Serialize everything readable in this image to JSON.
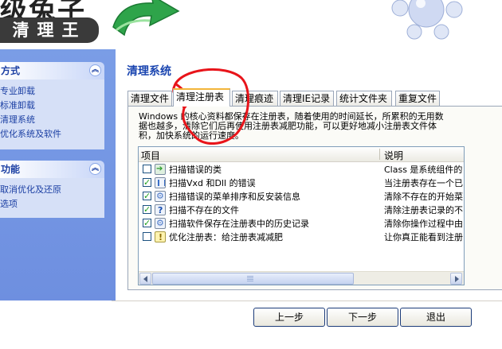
{
  "banner": {
    "logo_top_text": "级兔子",
    "logo_plate_text": "清理王"
  },
  "left_pane": {
    "panels": [
      {
        "title": "方式",
        "collapse_glyph": "︽",
        "items": [
          "专业卸载",
          "标准卸载",
          "清理系统",
          "优化系统及软件"
        ]
      },
      {
        "title": "功能",
        "collapse_glyph": "︽",
        "items": [
          "取消优化及还原",
          "选项"
        ]
      }
    ]
  },
  "main": {
    "title": "清理系统",
    "tabs": [
      {
        "label": "清理文件"
      },
      {
        "label": "清理注册表",
        "active": true
      },
      {
        "label": "清理痕迹"
      },
      {
        "label": "清理IE记录"
      },
      {
        "label": "统计文件夹"
      },
      {
        "label": "重复文件"
      }
    ],
    "description_lines": [
      "Windows 的核心资料都保存在注册表，随着使用的时间延长，所累积的无用数",
      "据也越多，清除它们后再使用注册表减肥功能，可以更好地减小注册表文件体",
      "积，加快系统的运行速度。"
    ],
    "list": {
      "columns": [
        "项目",
        "说明"
      ],
      "rows": [
        {
          "checked": false,
          "icon": "arrow-icon",
          "item": "扫描错误的类",
          "desc": "Class 是系统组件的"
        },
        {
          "checked": true,
          "icon": "document-icon",
          "item": "扫描Vxd 和Dll 的错误",
          "desc": "当注册表存在一个已"
        },
        {
          "checked": true,
          "icon": "gear-icon",
          "item": "扫描错误的菜单排序和反安装信息",
          "desc": "清除不存在的开始菜"
        },
        {
          "checked": true,
          "icon": "question-icon",
          "item": "扫描不存在的文件",
          "desc": "清除注册表记录的不"
        },
        {
          "checked": true,
          "icon": "gear-icon",
          "item": "扫描软件保存在注册表中的历史记录",
          "desc": "清除你操作过程中由"
        },
        {
          "checked": false,
          "icon": "warning-icon",
          "item": "优化注册表：给注册表减减肥",
          "desc": "让你真正能看到注册"
        }
      ]
    }
  },
  "buttons": {
    "prev": "上一步",
    "next": "下一步",
    "exit": "退出"
  },
  "colors": {
    "accent_blue": "#1a45b0",
    "pane_blue": "#7a9de6",
    "annotation_red": "#e8141a"
  }
}
